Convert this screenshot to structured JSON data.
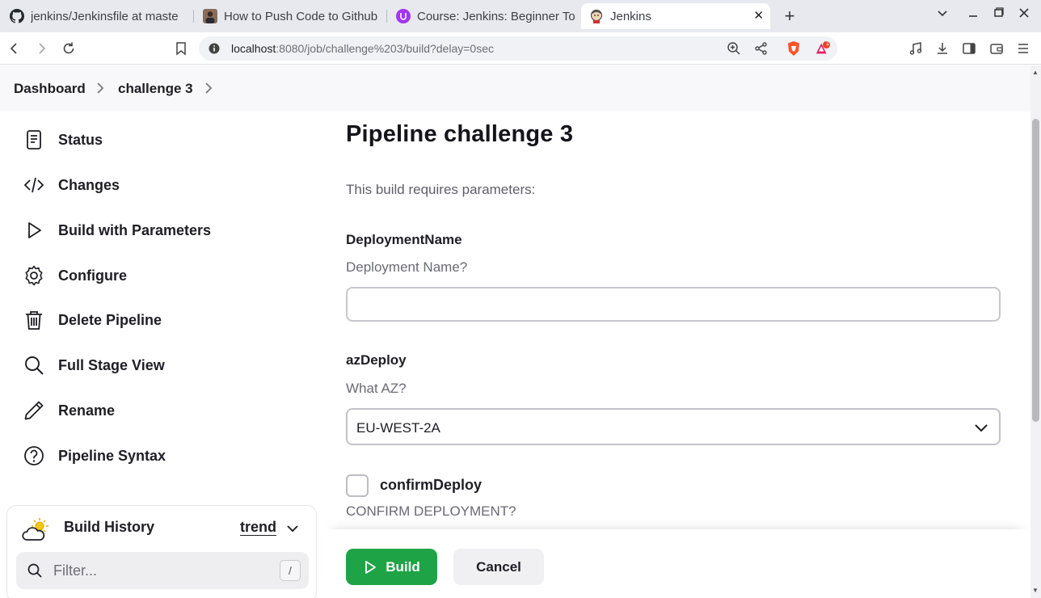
{
  "browser": {
    "tabs": [
      {
        "label": "jenkins/Jenkinsfile at maste",
        "icon": "github-icon"
      },
      {
        "label": "How to Push Code to Github",
        "icon": "person-thumbnail-icon"
      },
      {
        "label": "Course: Jenkins: Beginner To",
        "icon": "udemy-icon"
      },
      {
        "label": "Jenkins",
        "icon": "jenkins-icon",
        "active": true
      }
    ],
    "url_host": "localhost",
    "url_rest": ":8080/job/challenge%203/build?delay=0sec",
    "notification_count": "1"
  },
  "breadcrumb": {
    "items": [
      "Dashboard",
      "challenge 3"
    ]
  },
  "sidebar": {
    "items": [
      {
        "label": "Status",
        "icon": "notepad-icon"
      },
      {
        "label": "Changes",
        "icon": "code-icon"
      },
      {
        "label": "Build with Parameters",
        "icon": "play-icon"
      },
      {
        "label": "Configure",
        "icon": "gear-icon"
      },
      {
        "label": "Delete Pipeline",
        "icon": "trash-icon"
      },
      {
        "label": "Full Stage View",
        "icon": "search-icon"
      },
      {
        "label": "Rename",
        "icon": "pencil-icon"
      },
      {
        "label": "Pipeline Syntax",
        "icon": "help-circle-icon"
      }
    ],
    "history": {
      "title": "Build History",
      "trend": "trend",
      "filter_placeholder": "Filter...",
      "filter_shortcut": "/"
    }
  },
  "main": {
    "title": "Pipeline challenge 3",
    "intro": "This build requires parameters:",
    "params": [
      {
        "name": "DeploymentName",
        "description": "Deployment Name?",
        "value": ""
      },
      {
        "name": "azDeploy",
        "description": "What AZ?",
        "selected": "EU-WEST-2A"
      },
      {
        "name": "confirmDeploy",
        "description": "CONFIRM DEPLOYMENT?",
        "checked": false
      }
    ],
    "build_label": "Build",
    "cancel_label": "Cancel"
  },
  "colors": {
    "build_button": "#1ea446",
    "breadcrumb_bg": "#f8f8fa"
  }
}
